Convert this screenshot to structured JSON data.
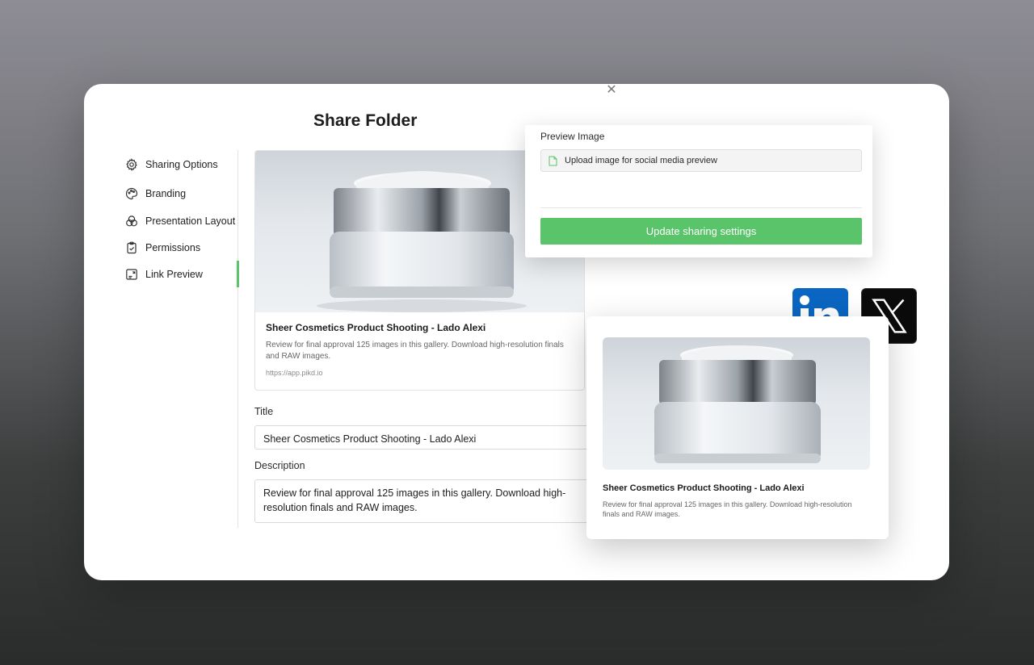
{
  "dialog": {
    "title": "Share Folder",
    "close_icon": "close-icon"
  },
  "sidebar": {
    "active_index": 4,
    "active_color": "#5cc46a",
    "items": [
      {
        "label": "Sharing Options",
        "icon": "gear-icon"
      },
      {
        "label": "Branding",
        "icon": "palette-icon"
      },
      {
        "label": "Presentation Layout",
        "icon": "layout-circles-icon"
      },
      {
        "label": "Permissions",
        "icon": "clipboard-check-icon"
      },
      {
        "label": "Link Preview",
        "icon": "link-preview-icon"
      }
    ]
  },
  "preview_card": {
    "title": "Sheer Cosmetics Product Shooting - Lado Alexi",
    "description": "Review for final approval 125 images in this gallery. Download high-resolution finals and RAW images.",
    "url": "https://app.pikd.io"
  },
  "form": {
    "title_label": "Title",
    "title_value": "Sheer Cosmetics Product Shooting -  Lado Alexi",
    "description_label": "Description",
    "description_value": "Review for final approval 125 images in this gallery. Download high-resolution finals and RAW images."
  },
  "preview_image_panel": {
    "label": "Preview Image",
    "upload_text": "Upload image for social media preview",
    "upload_icon": "file-icon",
    "update_button": "Update sharing settings",
    "button_color": "#5ac46a"
  },
  "social": {
    "linkedin_icon": "linkedin-icon",
    "x_icon": "x-logo-icon",
    "linkedin_color": "#0a66c2"
  },
  "social_card": {
    "title": "Sheer Cosmetics Product Shooting - Lado Alexi",
    "description": "Review for final approval 125 images in this gallery. Download high-resolution finals and RAW images."
  }
}
